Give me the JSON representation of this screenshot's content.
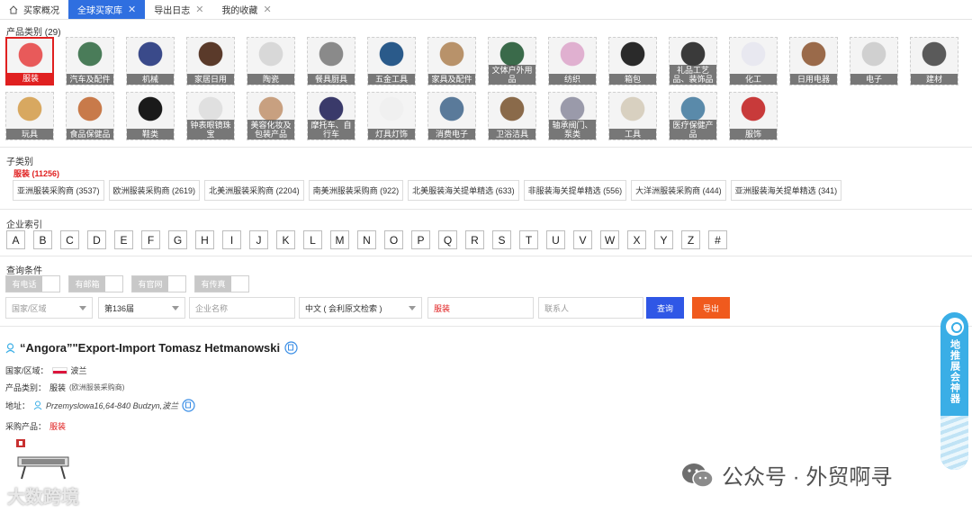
{
  "tabs": [
    {
      "label": "买家概况",
      "active": false
    },
    {
      "label": "全球买家库",
      "active": true
    },
    {
      "label": "导出日志",
      "active": false
    },
    {
      "label": "我的收藏",
      "active": false
    }
  ],
  "product_category": {
    "title": "产品类别 (29)",
    "items": [
      {
        "label": "服装",
        "selected": true,
        "icon": "clothing",
        "color": "#e85a5a"
      },
      {
        "label": "汽车及配件",
        "icon": "auto-parts",
        "color": "#4a7c59"
      },
      {
        "label": "机械",
        "icon": "machinery",
        "color": "#3a4a8a"
      },
      {
        "label": "家居日用",
        "icon": "home-goods",
        "color": "#5a3a2a"
      },
      {
        "label": "陶瓷",
        "icon": "ceramics",
        "color": "#d8d8d8"
      },
      {
        "label": "餐具厨具",
        "icon": "kitchenware",
        "color": "#8a8a8a"
      },
      {
        "label": "五金工具",
        "icon": "hardware",
        "color": "#2a5a8a"
      },
      {
        "label": "家具及配件",
        "icon": "furniture",
        "color": "#b8926a"
      },
      {
        "label": "文体户外用品",
        "icon": "sports-outdoor",
        "color": "#3a6a4a"
      },
      {
        "label": "纺织",
        "icon": "textile",
        "color": "#e0b0d0"
      },
      {
        "label": "箱包",
        "icon": "luggage",
        "color": "#2a2a2a"
      },
      {
        "label": "礼品工艺品、装饰品",
        "icon": "gifts-crafts",
        "color": "#3a3a3a"
      },
      {
        "label": "化工",
        "icon": "chemical",
        "color": "#e8e8f0"
      },
      {
        "label": "日用电器",
        "icon": "appliances",
        "color": "#9a6a4a"
      },
      {
        "label": "电子",
        "icon": "electronics",
        "color": "#d0d0d0"
      },
      {
        "label": "建材",
        "icon": "building-materials",
        "color": "#5a5a5a"
      },
      {
        "label": "玩具",
        "icon": "toys",
        "color": "#d8a860"
      },
      {
        "label": "食品保健品",
        "icon": "food-health",
        "color": "#c87a4a"
      },
      {
        "label": "鞋类",
        "icon": "shoes",
        "color": "#1a1a1a"
      },
      {
        "label": "钟表眼镜珠宝",
        "icon": "watches-jewelry",
        "color": "#e0e0e0"
      },
      {
        "label": "美容化妆及包装产品",
        "icon": "cosmetics",
        "color": "#c8a080"
      },
      {
        "label": "摩托车、自行车",
        "icon": "motorcycle-bike",
        "color": "#3a3a6a"
      },
      {
        "label": "灯具灯饰",
        "icon": "lighting",
        "color": "#f0f0f0"
      },
      {
        "label": "消费电子",
        "icon": "consumer-electronics",
        "color": "#5a7a9a"
      },
      {
        "label": "卫浴洁具",
        "icon": "sanitary-ware",
        "color": "#8a6a4a"
      },
      {
        "label": "轴承阀门、泵类",
        "icon": "bearings-valves",
        "color": "#9a9aaa"
      },
      {
        "label": "工具",
        "icon": "tools",
        "color": "#d8d0c0"
      },
      {
        "label": "医疗保健产品",
        "icon": "medical",
        "color": "#5a8aaa"
      },
      {
        "label": "服饰",
        "icon": "apparel",
        "color": "#c83a3a"
      }
    ]
  },
  "subcategory": {
    "title": "子类别",
    "selected_label": "服装 (11256)",
    "chips": [
      "亚洲服装采购商 (3537)",
      "欧洲服装采购商 (2619)",
      "北美洲服装采购商 (2204)",
      "南美洲服装采购商 (922)",
      "北美服装海关提单精选 (633)",
      "非服装海关提单精选 (556)",
      "大洋洲服装采购商 (444)",
      "亚洲服装海关提单精选 (341)"
    ]
  },
  "company_index": {
    "title": "企业索引",
    "letters": [
      "A",
      "B",
      "C",
      "D",
      "E",
      "F",
      "G",
      "H",
      "I",
      "J",
      "K",
      "L",
      "M",
      "N",
      "O",
      "P",
      "Q",
      "R",
      "S",
      "T",
      "U",
      "V",
      "W",
      "X",
      "Y",
      "Z",
      "#"
    ]
  },
  "query": {
    "title": "查询条件",
    "toggles": [
      "有电话",
      "有邮箱",
      "有官网",
      "有传真"
    ],
    "country_placeholder": "国家/区域",
    "session_value": "第136届",
    "company_placeholder": "企业名称",
    "language_value": "中文 ( 会利原文检索 )",
    "keyword_value": "服装",
    "contact_placeholder": "联系人",
    "search_label": "查询",
    "export_label": "导出"
  },
  "company": {
    "name": "“Angora”\"Export-Import Tomasz Hetmanowski",
    "country_label": "国家/区域：",
    "country_value": "波兰",
    "category_label": "产品类别：",
    "category_value": "服装",
    "category_note": "(欧洲服装采购商)",
    "address_label": "地址：",
    "address_value": "Przemyslowa16,64-840 Budzyn,波兰",
    "purchase_label": "采购产品：",
    "purchase_value": "服装"
  },
  "side_widget": {
    "label": "地推展会神器"
  },
  "watermarks": {
    "wechat": "公众号 · 外贸啊寻",
    "bottom": "大数跨境"
  },
  "colors": {
    "accent_blue": "#2f6fe0",
    "search_blue": "#2f57e6",
    "export_orange": "#f05a1d",
    "selected_red": "#e02020",
    "widget_blue": "#3aaee6"
  }
}
